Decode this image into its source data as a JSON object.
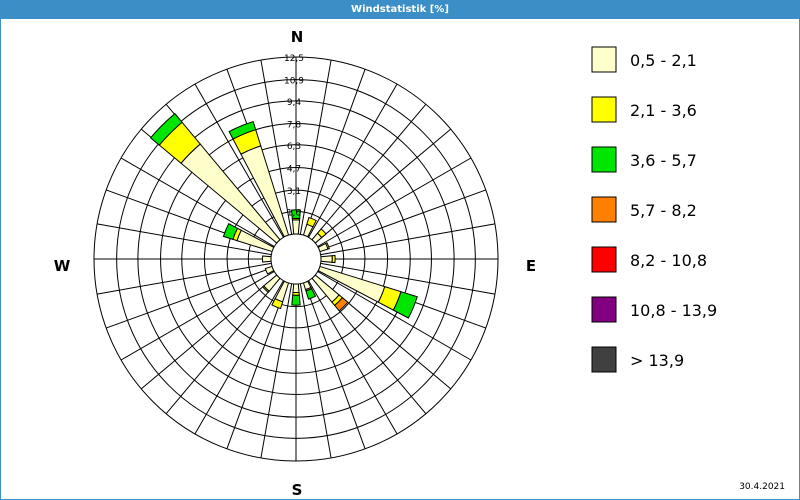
{
  "window": {
    "title": "Windstatistik [%]"
  },
  "footer": {
    "date": "30.4.2021"
  },
  "chart_data": {
    "type": "windrose",
    "title": "Windstatistik [%]",
    "unit": "%",
    "directions": [
      "N",
      "NNE",
      "NE",
      "ENE",
      "E",
      "ESE",
      "SE",
      "SSE",
      "S",
      "SSW",
      "SW",
      "WSW",
      "W",
      "WNW",
      "NW",
      "NNW"
    ],
    "direction_angles_deg": [
      0,
      22.5,
      45,
      67.5,
      90,
      112.5,
      135,
      157.5,
      180,
      202.5,
      225,
      247.5,
      270,
      292.5,
      315,
      337.5
    ],
    "radial_ticks": [
      "1,6",
      "3,1",
      "4,7",
      "6,3",
      "7,8",
      "9,4",
      "10,9",
      "12,5"
    ],
    "radial_tick_values": [
      1.6,
      3.1,
      4.7,
      6.3,
      7.8,
      9.4,
      10.9,
      12.5
    ],
    "radial_max": 12.5,
    "compass_labels": {
      "N": "N",
      "E": "E",
      "S": "S",
      "W": "W"
    },
    "legend": [
      {
        "label": "0,5 - 2,1",
        "color": "#ffffcc"
      },
      {
        "label": "2,1 - 3,6",
        "color": "#ffff00"
      },
      {
        "label": "3,6 - 5,7",
        "color": "#00e600"
      },
      {
        "label": "5,7 - 8,2",
        "color": "#ff8000"
      },
      {
        "label": "8,2 - 10,8",
        "color": "#ff0000"
      },
      {
        "label": "10,8 - 13,9",
        "color": "#800080"
      },
      {
        "label": " > 13,9",
        "color": "#404040"
      }
    ],
    "series": [
      {
        "name": "0,5 - 2,1",
        "values": [
          1.0,
          0.8,
          0.6,
          0.6,
          0.8,
          4.8,
          2.2,
          0.5,
          0.6,
          1.4,
          1.2,
          0.5,
          0.6,
          2.6,
          8.8,
          6.6
        ]
      },
      {
        "name": "2,1 - 3,6",
        "values": [
          0.1,
          0.5,
          0.4,
          0.1,
          0.2,
          1.2,
          0.3,
          0.1,
          0.2,
          0.5,
          0.1,
          0.0,
          0.0,
          0.3,
          2.0,
          1.2
        ]
      },
      {
        "name": "3,6 - 5,7",
        "values": [
          0.6,
          0.0,
          0.0,
          0.0,
          0.0,
          1.2,
          0.0,
          0.6,
          0.7,
          0.0,
          0.0,
          0.0,
          0.0,
          0.7,
          0.8,
          0.6
        ]
      },
      {
        "name": "5,7 - 8,2",
        "values": [
          0.0,
          0.0,
          0.0,
          0.0,
          0.0,
          0.0,
          0.5,
          0.0,
          0.0,
          0.0,
          0.0,
          0.0,
          0.0,
          0.0,
          0.0,
          0.0
        ]
      },
      {
        "name": "8,2 - 10,8",
        "values": [
          0,
          0,
          0,
          0,
          0,
          0,
          0,
          0,
          0,
          0,
          0,
          0,
          0,
          0,
          0,
          0
        ]
      },
      {
        "name": "10,8 - 13,9",
        "values": [
          0,
          0,
          0,
          0,
          0,
          0,
          0,
          0,
          0,
          0,
          0,
          0,
          0,
          0,
          0,
          0
        ]
      },
      {
        "name": " > 13,9",
        "values": [
          0,
          0,
          0,
          0,
          0,
          0,
          0,
          0,
          0,
          0,
          0,
          0,
          0,
          0,
          0,
          0
        ]
      }
    ],
    "grid": true,
    "legend_position": "right"
  }
}
